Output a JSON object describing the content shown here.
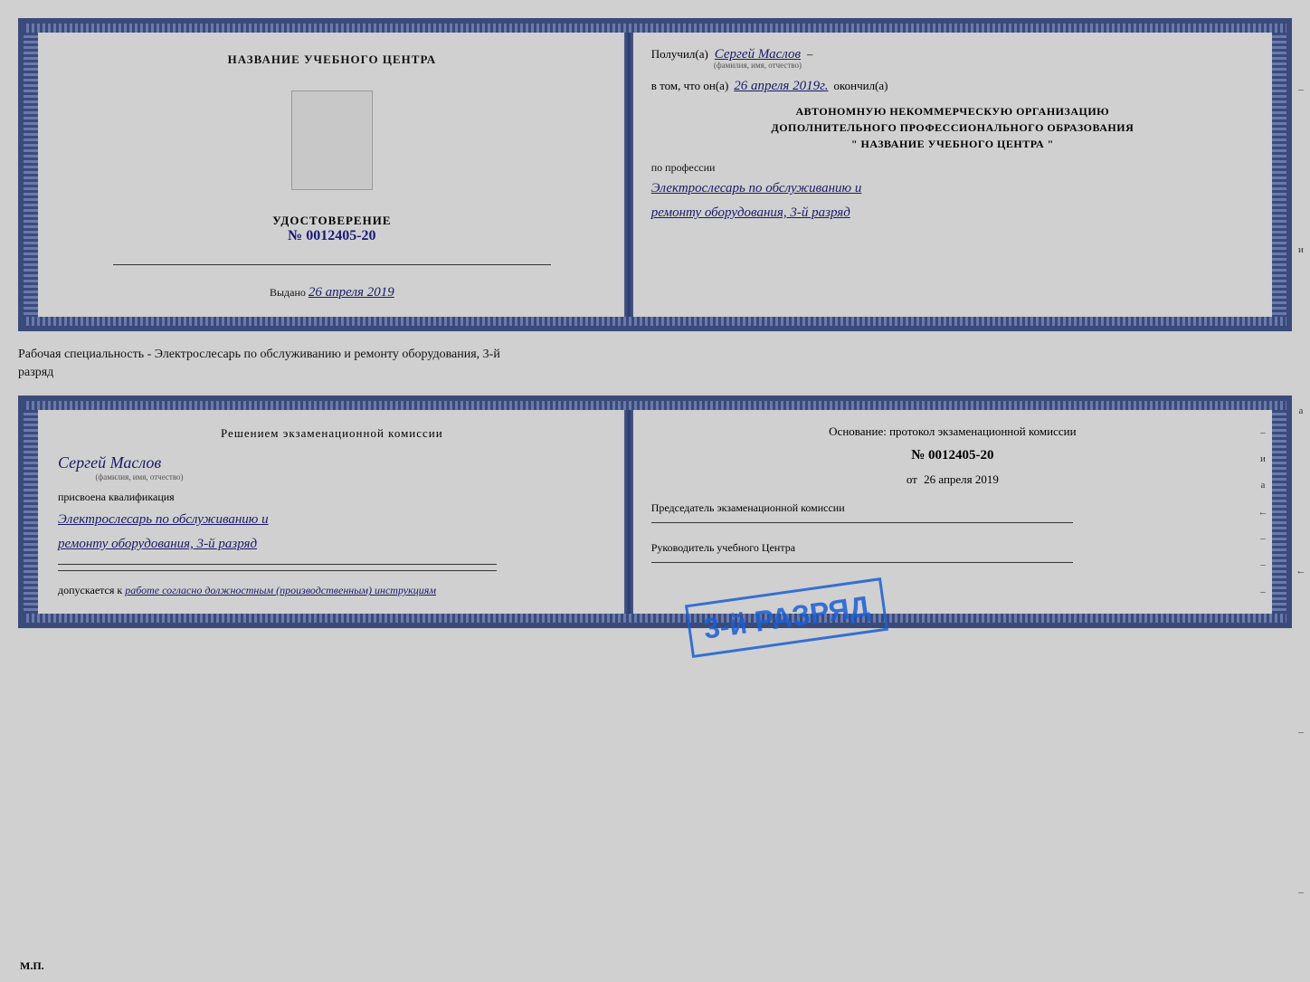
{
  "card1": {
    "left": {
      "title": "НАЗВАНИЕ УЧЕБНОГО ЦЕНТРА",
      "udostoverenie_label": "УДОСТОВЕРЕНИЕ",
      "number": "№ 0012405-20",
      "vydano_label": "Выдано",
      "vydano_date": "26 апреля 2019",
      "mp_label": "М.П."
    },
    "right": {
      "poluchil_label": "Получил(а)",
      "recipient_name": "Сергей Маслов",
      "fio_sub": "(фамилия, имя, отчество)",
      "dash": "–",
      "v_tom_chto_label": "в том, что он(а)",
      "completion_date": "26 апреля 2019г.",
      "okončil_label": "окончил(а)",
      "org_line1": "АВТОНОМНУЮ НЕКОММЕРЧЕСКУЮ ОРГАНИЗАЦИЮ",
      "org_line2": "ДОПОЛНИТЕЛЬНОГО ПРОФЕССИОНАЛЬНОГО ОБРАЗОВАНИЯ",
      "org_line3": "\"  НАЗВАНИЕ УЧЕБНОГО ЦЕНТРА   \"",
      "po_professii_label": "по профессии",
      "profession_line1": "Электрослесарь по обслуживанию и",
      "profession_line2": "ремонту оборудования, 3-й разряд"
    }
  },
  "between_text_line1": "Рабочая специальность - Электрослесарь по обслуживанию и ремонту оборудования, 3-й",
  "between_text_line2": "разряд",
  "card2": {
    "left": {
      "resheniem_title": "Решением  экзаменационной  комиссии",
      "name_handwritten": "Сергей Маслов",
      "fio_sub": "(фамилия, имя, отчество)",
      "prisvoena_label": "присвоена квалификация",
      "qualification_line1": "Электрослесарь по обслуживанию и",
      "qualification_line2": "ремонту оборудования, 3-й разряд",
      "dopuskaetsya_prefix": "допускается к",
      "dopuskaetsya_text": "работе согласно должностным (производственным) инструкциям"
    },
    "right": {
      "osnovanie_label": "Основание: протокол экзаменационной  комиссии",
      "number": "№  0012405-20",
      "ot_label": "от",
      "ot_date": "26 апреля 2019",
      "predsedatel_label": "Председатель экзаменационной комиссии",
      "rukovoditel_label": "Руководитель учебного Центра"
    },
    "stamp": {
      "text": "3-й РАЗРЯД"
    }
  },
  "side_chars": [
    "–",
    "и",
    "а",
    "←",
    "–",
    "–",
    "–",
    "–"
  ]
}
